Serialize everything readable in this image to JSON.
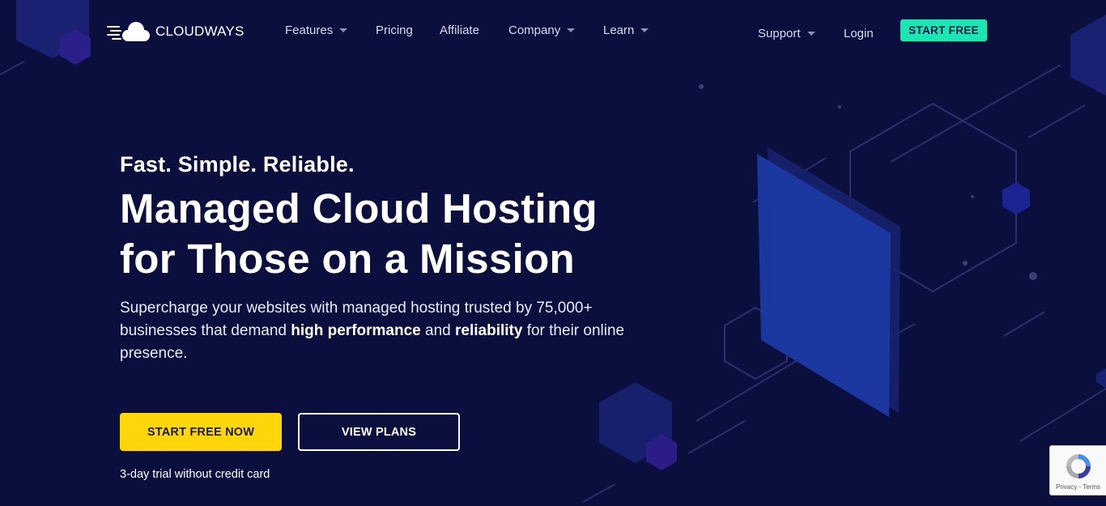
{
  "brand": {
    "name": "CLOUDWAYS"
  },
  "nav": {
    "features": "Features",
    "pricing": "Pricing",
    "affiliate": "Affiliate",
    "company": "Company",
    "learn": "Learn",
    "support": "Support",
    "login": "Login",
    "start_free": "START FREE"
  },
  "hero": {
    "tagline": "Fast. Simple. Reliable.",
    "headline_line1": "Managed Cloud Hosting",
    "headline_line2": "for Those on a Mission",
    "desc_part1": "Supercharge your websites with managed hosting trusted by 75,000+ businesses that demand ",
    "desc_bold1": "high performance",
    "desc_part2": " and ",
    "desc_bold2": "reliability",
    "desc_part3": " for their online presence.",
    "cta_primary": "START FREE NOW",
    "cta_secondary": "VIEW PLANS",
    "trial_note": "3-day trial without credit card"
  },
  "recaptcha": {
    "links": "Privacy - Terms"
  },
  "colors": {
    "background": "#0b0f3d",
    "accent_green": "#1ce7b4",
    "accent_yellow": "#ffd60a",
    "art_blue": "#1e3aa8"
  },
  "icons": {
    "logo": "cloud-logo-icon",
    "caret": "caret-down-icon",
    "recaptcha": "recaptcha-icon"
  }
}
